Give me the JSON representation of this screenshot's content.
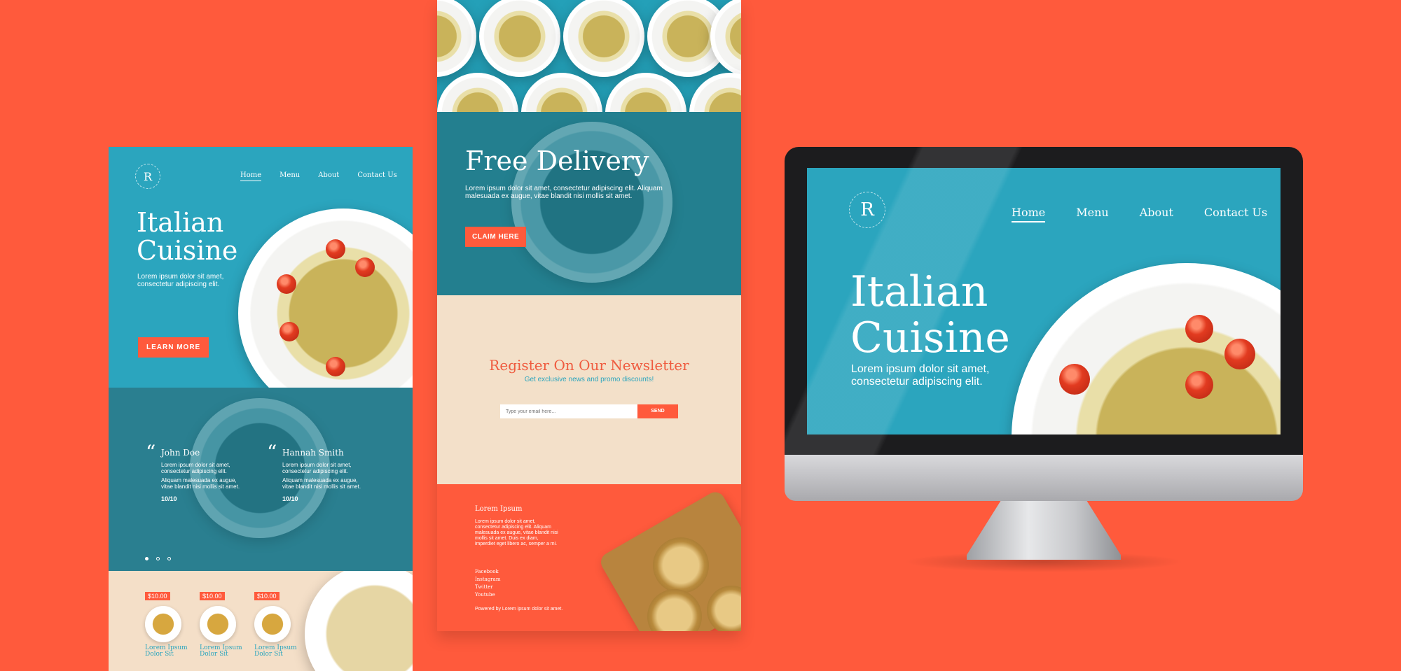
{
  "colors": {
    "background": "#ff5a3c",
    "teal": "#2ba5be",
    "cream": "#f3e0c9",
    "accent": "#ff5a3c"
  },
  "left_page": {
    "logo_letter": "R",
    "nav": [
      "Home",
      "Menu",
      "About",
      "Contact Us"
    ],
    "hero_title_line1": "Italian",
    "hero_title_line2": "Cuisine",
    "hero_subtitle": "Lorem ipsum dolor sit amet, consectetur adipiscing elit.",
    "cta": "LEARN MORE",
    "testimonials": [
      {
        "name": "John Doe",
        "text1": "Lorem ipsum dolor sit amet, consectetur adipiscing elit.",
        "text2": "Aliquam malesuada ex augue, vitae blandit nisi mollis sit amet.",
        "score": "10/10"
      },
      {
        "name": "Hannah Smith",
        "text1": "Lorem ipsum dolor sit amet, consectetur adipiscing elit.",
        "text2": "Aliquam malesuada ex augue, vitae blandit nisi mollis sit amet.",
        "score": "10/10"
      }
    ],
    "menu_items": [
      {
        "price": "$10.00",
        "label": "Lorem Ipsum Dolor Sit"
      },
      {
        "price": "$10.00",
        "label": "Lorem Ipsum Dolor Sit"
      },
      {
        "price": "$10.00",
        "label": "Lorem Ipsum Dolor Sit"
      }
    ]
  },
  "middle_page": {
    "promo_title": "Free Delivery",
    "promo_text": "Lorem ipsum dolor sit amet, consectetur adipiscing elit. Aliquam malesuada ex augue, vitae blandit nisi mollis sit amet.",
    "promo_cta": "CLAIM HERE",
    "newsletter_title": "Register On Our Newsletter",
    "newsletter_subtitle": "Get exclusive news and promo discounts!",
    "email_placeholder": "Type your email here...",
    "send": "SEND",
    "footer_title": "Lorem Ipsum",
    "footer_text": "Lorem ipsum dolor sit amet, consectetur adipiscing elit. Aliquam malesuada ex augue, vitae blandit nisi mollis sit amet. Duis ex diam, imperdiet eget libero ac, semper a mi.",
    "social": [
      "Facebook",
      "Instagram",
      "Twitter",
      "Youtube"
    ],
    "powered_by": "Powered by Lorem ipsum dolor sit amet."
  },
  "monitor_page": {
    "logo_letter": "R",
    "nav": [
      "Home",
      "Menu",
      "About",
      "Contact Us"
    ],
    "title_line1": "Italian",
    "title_line2": "Cuisine",
    "subtitle": "Lorem ipsum dolor sit amet, consectetur adipiscing elit."
  }
}
